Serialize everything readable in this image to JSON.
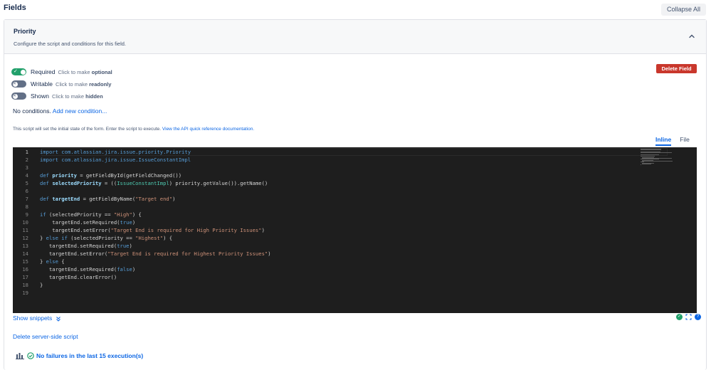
{
  "header": {
    "title": "Fields",
    "collapse_label": "Collapse All"
  },
  "field": {
    "name": "Priority",
    "description": "Configure the script and conditions for this field.",
    "delete_label": "Delete Field"
  },
  "toggles": [
    {
      "label": "Required",
      "state": "on",
      "hint_prefix": "Click to make",
      "hint_value": "optional"
    },
    {
      "label": "Writable",
      "state": "off",
      "hint_prefix": "Click to make",
      "hint_value": "readonly"
    },
    {
      "label": "Shown",
      "state": "off",
      "hint_prefix": "Click to make",
      "hint_value": "hidden"
    }
  ],
  "conditions": {
    "text": "No conditions.",
    "link": "Add new condition..."
  },
  "script_note": {
    "text": "This script will set the initial state of the form. Enter the script to execute.",
    "link": "View the API quick reference documentation."
  },
  "tabs": [
    {
      "label": "Inline",
      "active": true
    },
    {
      "label": "File",
      "active": false
    }
  ],
  "editor": {
    "current_line": 1,
    "lines": [
      "import com.atlassian.jira.issue.priority.Priority",
      "import com.atlassian.jira.issue.IssueConstantImpl",
      "",
      "def priority = getFieldById(getFieldChanged())",
      "def selectedPriority = ((IssueConstantImpl) priority.getValue()).getName()",
      "",
      "def targetEnd = getFieldByName(\"Target end\")",
      "",
      "if (selectedPriority == \"High\") {",
      "    targetEnd.setRequired(true)",
      "    targetEnd.setError(\"Target End is required for High Priority Issues\")",
      "} else if (selectedPriority == \"Highest\") {",
      "   targetEnd.setRequired(true)",
      "   targetEnd.setError(\"Target End is required for Highest Priority Issues\")",
      "} else {",
      "   targetEnd.setRequired(false)",
      "   targetEnd.clearError()",
      "}",
      ""
    ]
  },
  "snippets_label": "Show snippets",
  "delete_script_label": "Delete server-side script",
  "failures_label": "No failures in the last 15 execution(s)",
  "icons": {
    "chevron": "chevron-up-icon",
    "snippets": "double-chevron-down-icon",
    "status_ok": "check-circle-icon",
    "fullscreen": "expand-icon",
    "help": "help-icon",
    "chart": "bar-chart-icon"
  },
  "colors": {
    "accent": "#0c66e4",
    "success": "#22a06b",
    "danger": "#c9372c",
    "editor_bg": "#1e1e1e"
  }
}
